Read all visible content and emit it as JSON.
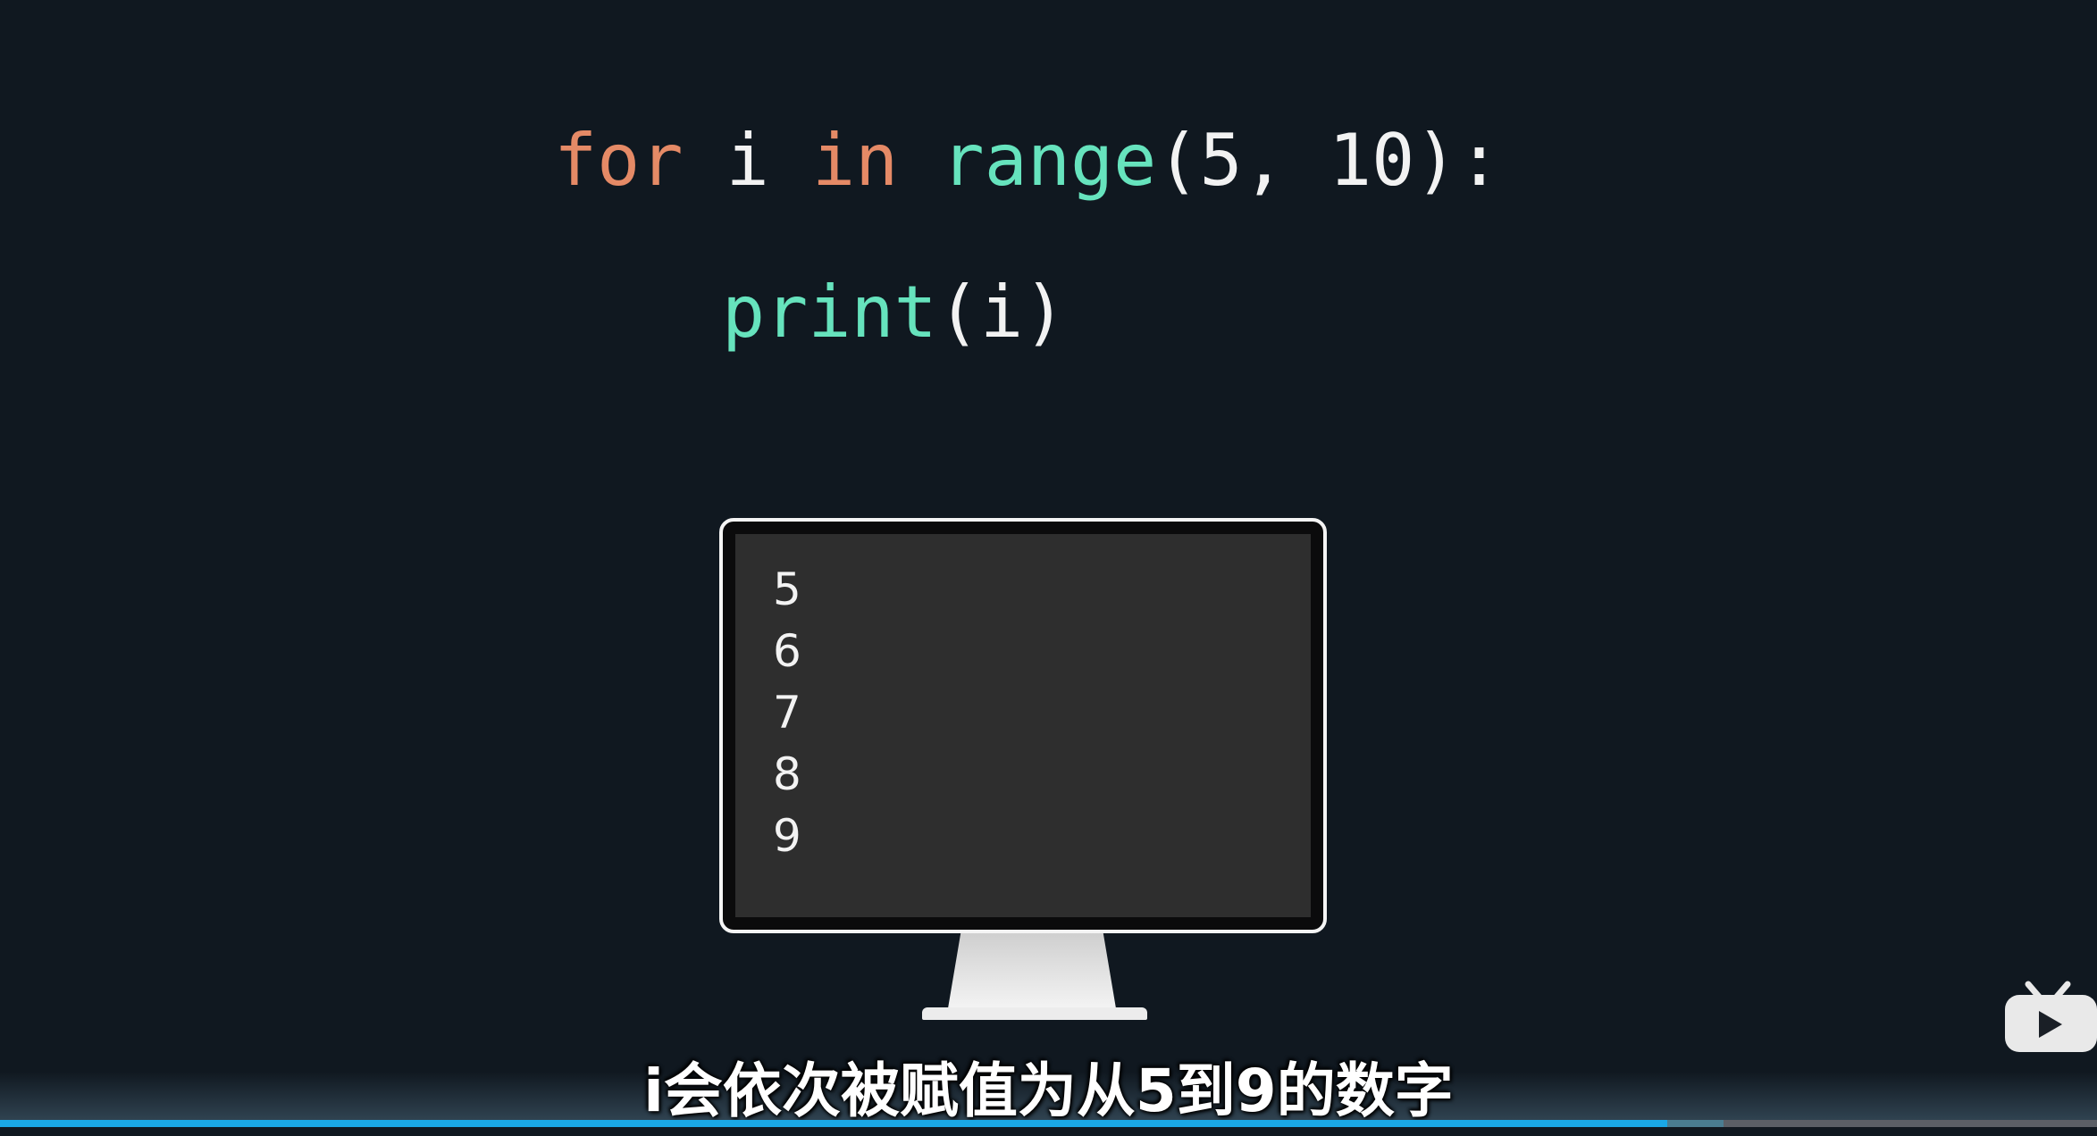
{
  "code": {
    "line1": {
      "kw_for": "for",
      "var_i": " i ",
      "kw_in": "in",
      "sp": " ",
      "fn_range": "range",
      "args": "(5, 10):"
    },
    "line2": {
      "fn_print": "print",
      "args": "(i)"
    }
  },
  "terminal": {
    "output": [
      "5",
      "6",
      "7",
      "8",
      "9"
    ]
  },
  "subtitle": "i会依次被赋值为从5到9的数字",
  "player": {
    "progress": 0.795,
    "buffered": 0.822
  },
  "colors": {
    "background": "#101820",
    "keyword": "#e58a66",
    "function": "#66e3bd",
    "progress": "#1aa8e6"
  },
  "icons": {
    "watermark": "bilibili-tv-icon"
  }
}
